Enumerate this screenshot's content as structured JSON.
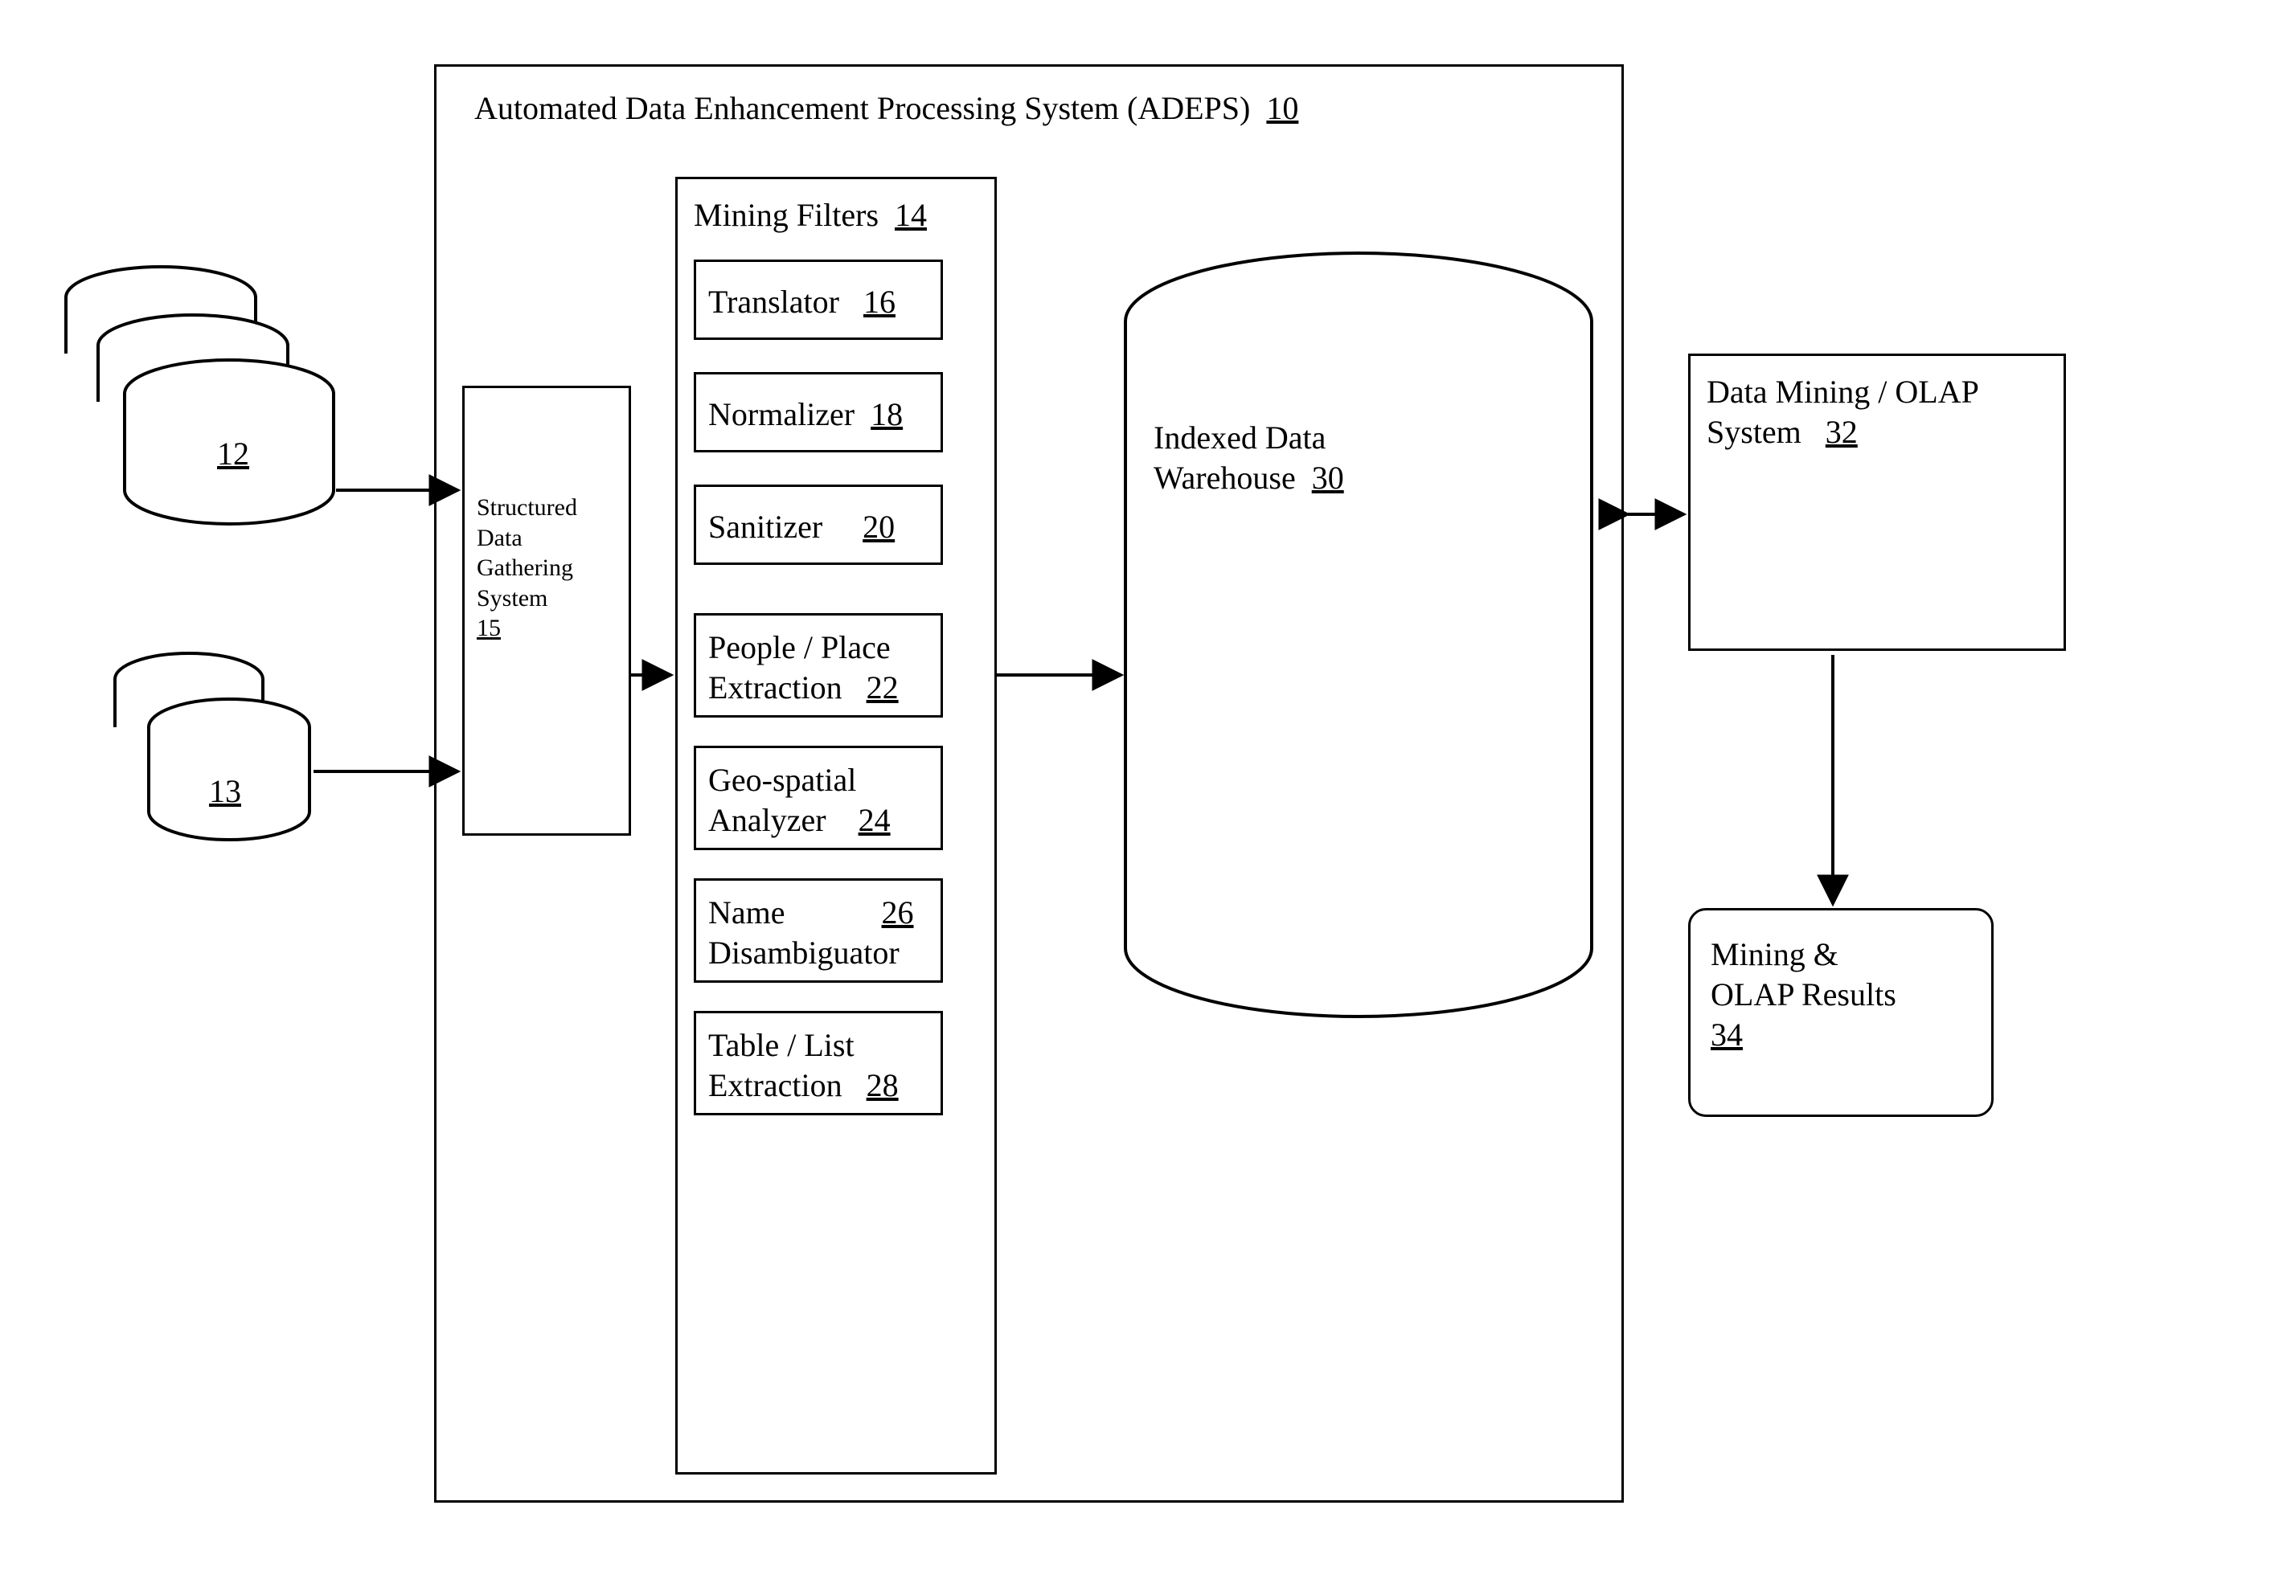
{
  "system": {
    "title": "Automated Data Enhancement Processing System (ADEPS)",
    "ref": "10"
  },
  "sources": {
    "db12_ref": "12",
    "db13_ref": "13"
  },
  "gathering": {
    "line1": "Structured",
    "line2": "Data",
    "line3": "Gathering",
    "line4": "System",
    "ref": "15"
  },
  "filters": {
    "title": "Mining Filters",
    "ref": "14",
    "items": [
      {
        "name": "Translator",
        "ref": "16"
      },
      {
        "name": "Normalizer",
        "ref": "18"
      },
      {
        "name": "Sanitizer",
        "ref": "20"
      },
      {
        "name": "People / Place Extraction",
        "ref": "22"
      },
      {
        "name": "Geo-spatial Analyzer",
        "ref": "24"
      },
      {
        "name_l1": "Name",
        "name_l2": "Disambiguator",
        "ref": "26"
      },
      {
        "name": "Table / List Extraction",
        "ref": "28"
      }
    ]
  },
  "warehouse": {
    "line1": "Indexed Data",
    "line2": "Warehouse",
    "ref": "30"
  },
  "olap": {
    "line1": "Data Mining / OLAP",
    "line2": "System",
    "ref": "32"
  },
  "results": {
    "line1": "Mining  &",
    "line2": "OLAP Results",
    "ref": "34"
  }
}
